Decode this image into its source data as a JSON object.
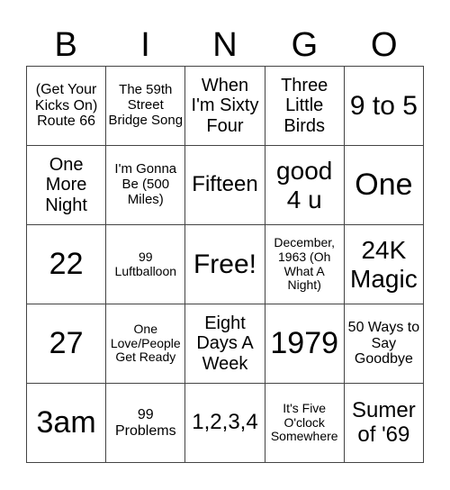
{
  "header": [
    "B",
    "I",
    "N",
    "G",
    "O"
  ],
  "cells": [
    "(Get Your Kicks On) Route 66",
    "The 59th Street Bridge Song",
    "When I'm Sixty Four",
    "Three Little Birds",
    "9 to 5",
    "One More Night",
    "I'm Gonna Be (500 Miles)",
    "Fifteen",
    "good 4 u",
    "One",
    "22",
    "99 Luftballoon",
    "Free!",
    "December, 1963 (Oh What A Night)",
    "24K Magic",
    "27",
    "One Love/People Get Ready",
    "Eight Days A Week",
    "1979",
    "50 Ways to Say Goodbye",
    "3am",
    "99 Problems",
    "1,2,3,4",
    "It's Five O'clock Somewhere",
    "Sumer of '69"
  ]
}
